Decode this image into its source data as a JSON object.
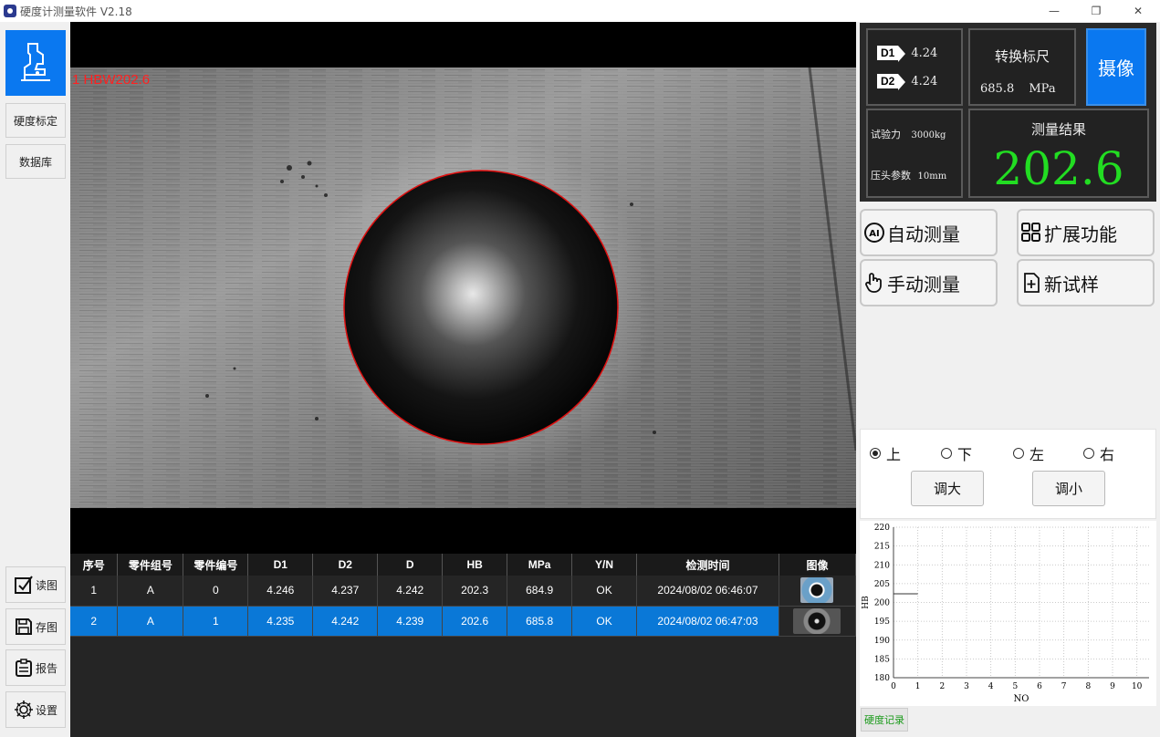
{
  "window": {
    "title": "硬度计测量软件 V2.18",
    "minimize_glyph": "—",
    "restore_glyph": "❐",
    "close_glyph": "✕"
  },
  "sidebar": {
    "top_icon": "microscope-icon",
    "calibrate_label": "硬度标定",
    "database_label": "数据库",
    "read_label": "读图",
    "save_label": "存图",
    "report_label": "报告",
    "settings_label": "设置"
  },
  "camera": {
    "overlay_label": "1 HBW202.6"
  },
  "table": {
    "headers": [
      "序号",
      "零件组号",
      "零件编号",
      "D1",
      "D2",
      "D",
      "HB",
      "MPa",
      "Y/N",
      "检测时间",
      "图像"
    ],
    "rows": [
      [
        "1",
        "A",
        "0",
        "4.246",
        "4.237",
        "4.242",
        "202.3",
        "684.9",
        "OK",
        "2024/08/02 06:46:07"
      ],
      [
        "2",
        "A",
        "1",
        "4.235",
        "4.242",
        "4.239",
        "202.6",
        "685.8",
        "OK",
        "2024/08/02 06:47:03"
      ]
    ],
    "selected_row": 1
  },
  "readout": {
    "d1_tag": "D1",
    "d1_value": "4.24",
    "d2_tag": "D2",
    "d2_value": "4.24",
    "convert_title": "转换标尺",
    "convert_value": "685.8",
    "convert_unit": "MPa",
    "shoot_label": "摄像",
    "force_label": "试验力",
    "force_value": "3000kg",
    "indenter_label": "压头参数",
    "indenter_value": "10mm",
    "result_title": "测量结果",
    "result_value": "202.6",
    "result_color": "#22dd22",
    "accent": "#0a78f0"
  },
  "functions": {
    "auto_measure": "自动测量",
    "extend": "扩展功能",
    "manual_measure": "手动测量",
    "new_sample": "新试样"
  },
  "direction": {
    "up": "上",
    "down": "下",
    "left": "左",
    "right": "右",
    "selected": "上",
    "enlarge": "调大",
    "shrink": "调小"
  },
  "chart_data": {
    "type": "line",
    "xlabel": "NO",
    "ylabel": "HB",
    "xlim": [
      0,
      10.5
    ],
    "ylim": [
      180,
      220
    ],
    "xticks": [
      0,
      1,
      2,
      3,
      4,
      5,
      6,
      7,
      8,
      9,
      10
    ],
    "yticks": [
      180,
      185,
      190,
      195,
      200,
      205,
      210,
      215,
      220
    ],
    "grid": true,
    "series": [
      {
        "x": [
          0,
          1
        ],
        "y": [
          202.3,
          202.3
        ]
      }
    ]
  },
  "record_label": "硬度记录"
}
